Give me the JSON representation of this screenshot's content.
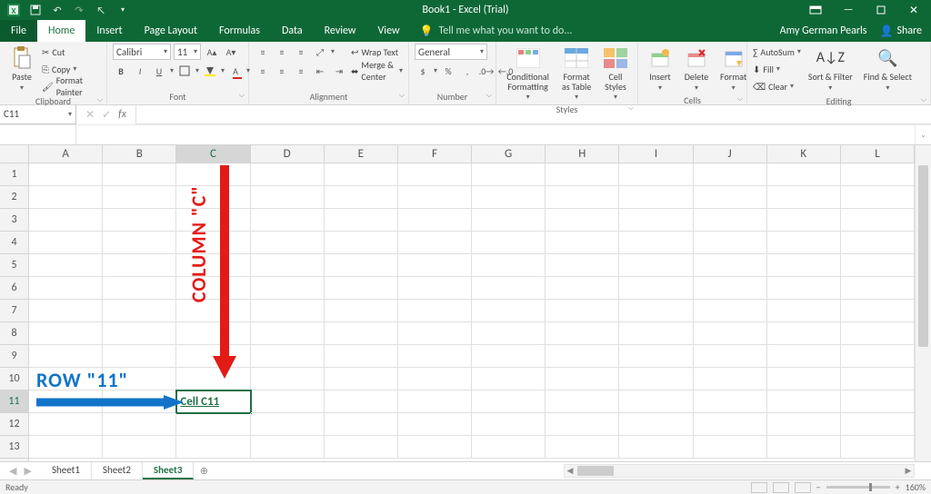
{
  "titlebar": {
    "title": "Book1 - Excel (Trial)"
  },
  "tabs": {
    "file": "File",
    "home": "Home",
    "insert": "Insert",
    "pagelayout": "Page Layout",
    "formulas": "Formulas",
    "data": "Data",
    "review": "Review",
    "view": "View",
    "tellme": "Tell me what you want to do...",
    "user": "Amy German Pearls",
    "share": "Share"
  },
  "ribbon": {
    "clipboard": {
      "paste": "Paste",
      "cut": "Cut",
      "copy": "Copy",
      "fmtpainter": "Format Painter",
      "label": "Clipboard"
    },
    "font": {
      "name": "Calibri",
      "size": "11",
      "label": "Font"
    },
    "alignment": {
      "wrap": "Wrap Text",
      "merge": "Merge & Center",
      "label": "Alignment"
    },
    "number": {
      "format": "General",
      "label": "Number"
    },
    "styles": {
      "cond": "Conditional Formatting",
      "table": "Format as Table",
      "cell": "Cell Styles",
      "label": "Styles"
    },
    "cells": {
      "insert": "Insert",
      "delete": "Delete",
      "format": "Format",
      "label": "Cells"
    },
    "editing": {
      "autosum": "AutoSum",
      "fill": "Fill",
      "clear": "Clear",
      "sort": "Sort & Filter",
      "find": "Find & Select",
      "label": "Editing"
    }
  },
  "formula_bar": {
    "namebox": "C11",
    "formula": ""
  },
  "grid": {
    "columns": [
      "A",
      "B",
      "C",
      "D",
      "E",
      "F",
      "G",
      "H",
      "I",
      "J",
      "K",
      "L"
    ],
    "rows": [
      "1",
      "2",
      "3",
      "4",
      "5",
      "6",
      "7",
      "8",
      "9",
      "10",
      "11",
      "12",
      "13"
    ],
    "active_col": "C",
    "active_row": "11",
    "active_cell_text": "Cell C11"
  },
  "annotations": {
    "column": "COLUMN \"C\"",
    "row": "ROW \"11\""
  },
  "sheets": {
    "tabs": [
      "Sheet1",
      "Sheet2",
      "Sheet3"
    ],
    "active": "Sheet3"
  },
  "status": {
    "ready": "Ready",
    "zoom": "160%"
  }
}
